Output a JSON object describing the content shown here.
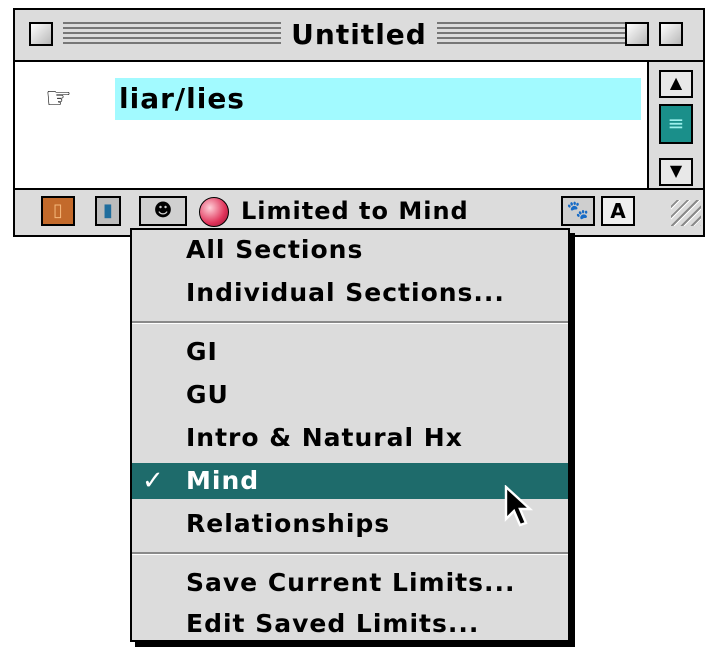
{
  "window": {
    "title": "Untitled",
    "entry_text": "liar/lies",
    "pointer_glyph": "☞",
    "limit_label": "Limited to Mind",
    "tools": {
      "book": "book-icon",
      "bottle": "bottle-icon",
      "face": "face-icon",
      "paw": "paw-icon",
      "a_label": "A"
    }
  },
  "menu": {
    "items": [
      {
        "label": "All Sections"
      },
      {
        "label": "Individual Sections..."
      },
      {
        "label": "GI"
      },
      {
        "label": "GU"
      },
      {
        "label": "Intro & Natural Hx"
      },
      {
        "label": "Mind",
        "checked": true
      },
      {
        "label": "Relationships"
      },
      {
        "label": "Save Current Limits..."
      },
      {
        "label": "Edit Saved Limits..."
      }
    ],
    "check_glyph": "✓"
  },
  "colors": {
    "highlight": "#a2faff",
    "selection": "#1e6b6b",
    "scroll_thumb": "#1a8f8a"
  }
}
